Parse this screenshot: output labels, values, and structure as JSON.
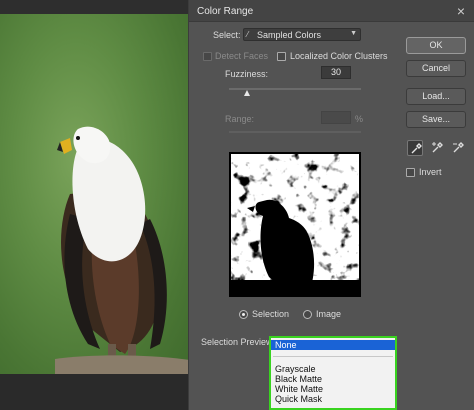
{
  "dialog": {
    "title": "Color Range",
    "select_label": "Select:",
    "select_value": "Sampled Colors",
    "detect_faces_label": "Detect Faces",
    "localized_label": "Localized Color Clusters",
    "fuzziness_label": "Fuzziness:",
    "fuzziness_value": "30",
    "range_label": "Range:",
    "range_unit": "%",
    "selection_label": "Selection",
    "image_label": "Image",
    "selection_preview_label": "Selection Preview:",
    "invert_label": "Invert"
  },
  "buttons": {
    "ok": "OK",
    "cancel": "Cancel",
    "load": "Load...",
    "save": "Save..."
  },
  "preview_options": {
    "selected": "None",
    "items": [
      "Grayscale",
      "Black Matte",
      "White Matte",
      "Quick Mask"
    ]
  },
  "icons": {
    "select_icon": "eyedropper-icon",
    "eyedroppers": [
      "eyedropper-icon",
      "eyedropper-plus-icon",
      "eyedropper-minus-icon"
    ]
  },
  "colors": {
    "dropdown_highlight": "#1a63d6",
    "dropdown_border": "#39d31f"
  }
}
